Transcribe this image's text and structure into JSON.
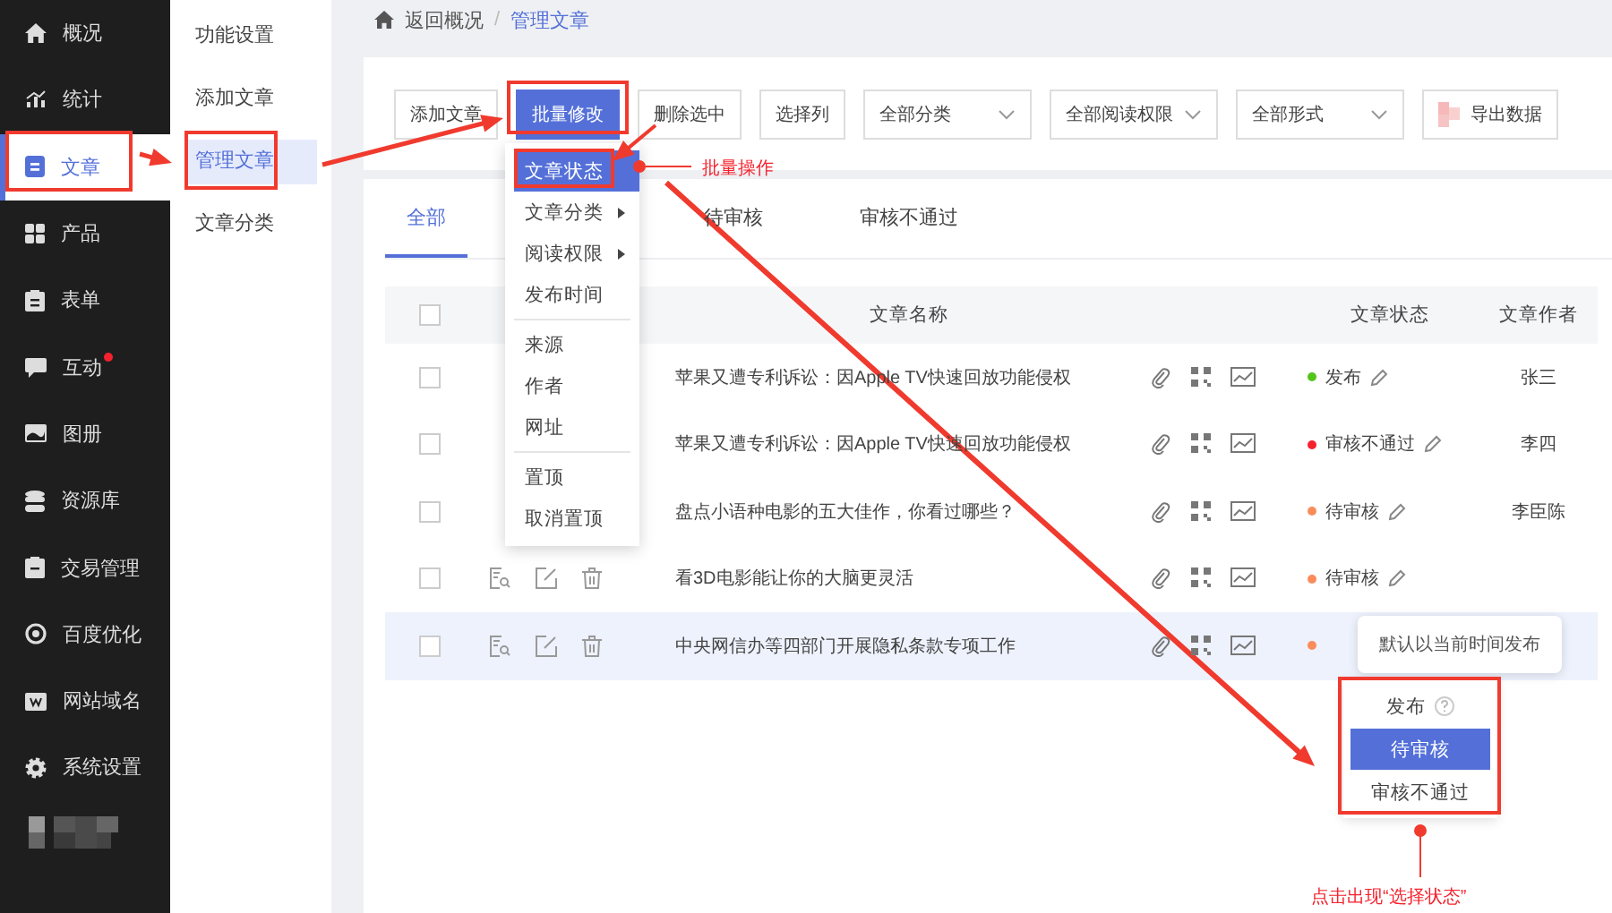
{
  "sidebar": {
    "items": [
      {
        "label": "概况",
        "selected": false,
        "badge": false
      },
      {
        "label": "统计",
        "selected": false,
        "badge": false
      },
      {
        "label": "文章",
        "selected": true,
        "badge": false
      },
      {
        "label": "产品",
        "selected": false,
        "badge": false
      },
      {
        "label": "表单",
        "selected": false,
        "badge": false
      },
      {
        "label": "互动",
        "selected": false,
        "badge": true
      },
      {
        "label": "图册",
        "selected": false,
        "badge": false
      },
      {
        "label": "资源库",
        "selected": false,
        "badge": false
      },
      {
        "label": "交易管理",
        "selected": false,
        "badge": false
      },
      {
        "label": "百度优化",
        "selected": false,
        "badge": false
      },
      {
        "label": "网站域名",
        "selected": false,
        "badge": false
      },
      {
        "label": "系统设置",
        "selected": false,
        "badge": false
      }
    ]
  },
  "submenu": {
    "items": [
      {
        "label": "功能设置",
        "selected": false
      },
      {
        "label": "添加文章",
        "selected": false
      },
      {
        "label": "管理文章",
        "selected": true
      },
      {
        "label": "文章分类",
        "selected": false
      }
    ]
  },
  "breadcrumb": {
    "back": "返回概况",
    "separator": "/",
    "current": "管理文章"
  },
  "toolbar": {
    "buttons": [
      {
        "label": "添加文章",
        "kind": "default"
      },
      {
        "label": "批量修改",
        "kind": "primary"
      },
      {
        "label": "删除选中",
        "kind": "default"
      },
      {
        "label": "选择列",
        "kind": "default"
      },
      {
        "label": "全部分类",
        "kind": "select"
      },
      {
        "label": "全部阅读权限",
        "kind": "select"
      },
      {
        "label": "全部形式",
        "kind": "select"
      },
      {
        "label": "导出数据",
        "kind": "export"
      }
    ]
  },
  "tabs": [
    {
      "label": "全部",
      "selected": true
    },
    {
      "label": "待审核",
      "selected": false
    },
    {
      "label": "审核不通过",
      "selected": false
    }
  ],
  "table": {
    "select_all": {
      "checked": false
    },
    "columns": [
      "文章名称",
      "文章状态",
      "文章作者"
    ],
    "rows": [
      {
        "title": "苹果又遭专利诉讼：因Apple TV快速回放功能侵权",
        "status": "发布",
        "color": "#52c41a",
        "author": "张三",
        "actions": false,
        "hovered": false
      },
      {
        "title": "苹果又遭专利诉讼：因Apple TV快速回放功能侵权",
        "status": "审核不通过",
        "color": "#f5222d",
        "author": "李四",
        "actions": false,
        "hovered": false
      },
      {
        "title": "盘点小语种电影的五大佳作，你看过哪些？",
        "status": "待审核",
        "color": "#fa8c5a",
        "author": "李臣陈",
        "actions": false,
        "hovered": false
      },
      {
        "title": "看3D电影能让你的大脑更灵活",
        "status": "待审核",
        "color": "#fa8c5a",
        "actions": true,
        "hovered": false
      },
      {
        "title": "中央网信办等四部门开展隐私条款专项工作",
        "color": "#fa8c5a",
        "actions": true,
        "hovered": true
      }
    ]
  },
  "batch_menu": {
    "groups": [
      [
        {
          "label": "文章状态",
          "selected": true,
          "submenu": false
        },
        {
          "label": "文章分类",
          "selected": false,
          "submenu": true
        },
        {
          "label": "阅读权限",
          "selected": false,
          "submenu": true
        },
        {
          "label": "发布时间",
          "selected": false,
          "submenu": false
        }
      ],
      [
        {
          "label": "来源",
          "selected": false,
          "submenu": false
        },
        {
          "label": "作者",
          "selected": false,
          "submenu": false
        },
        {
          "label": "网址",
          "selected": false,
          "submenu": false
        }
      ],
      [
        {
          "label": "置顶",
          "selected": false,
          "submenu": false
        },
        {
          "label": "取消置顶",
          "selected": false,
          "submenu": false
        }
      ]
    ]
  },
  "status_popover": {
    "tooltip": "默认以当前时间发布",
    "options": [
      {
        "label": "发布",
        "selected": false,
        "help": true
      },
      {
        "label": "待审核",
        "selected": true,
        "help": false
      },
      {
        "label": "审核不通过",
        "selected": false,
        "help": false
      }
    ]
  },
  "annotations": [
    {
      "label": "批量操作"
    },
    {
      "label": "点击出现“选择状态”"
    }
  ]
}
